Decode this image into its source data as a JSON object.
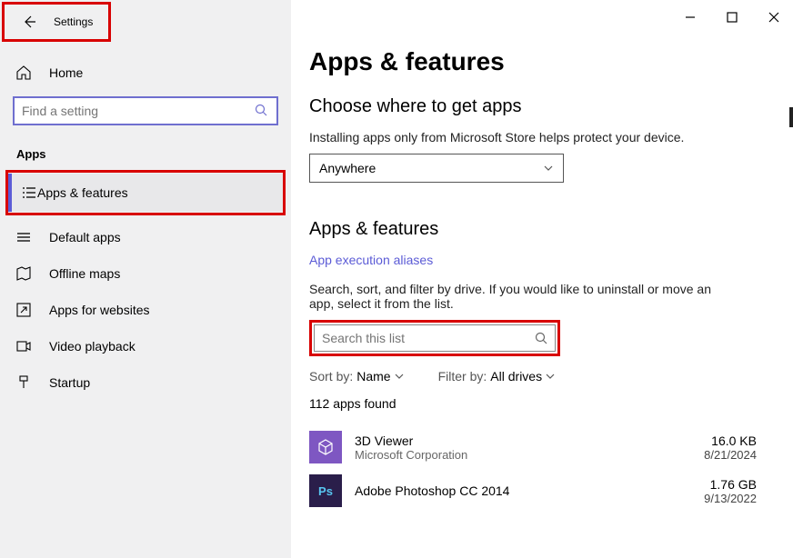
{
  "header": {
    "title": "Settings"
  },
  "sidebar": {
    "home": "Home",
    "search_placeholder": "Find a setting",
    "section": "Apps",
    "items": [
      "Apps & features",
      "Default apps",
      "Offline maps",
      "Apps for websites",
      "Video playback",
      "Startup"
    ]
  },
  "main": {
    "page_title": "Apps & features",
    "get_apps_heading": "Choose where to get apps",
    "get_apps_desc": "Installing apps only from Microsoft Store helps protect your device.",
    "get_apps_value": "Anywhere",
    "section_heading": "Apps & features",
    "aliases_link": "App execution aliases",
    "list_desc": "Search, sort, and filter by drive. If you would like to uninstall or move an app, select it from the list.",
    "search_placeholder": "Search this list",
    "sort_label": "Sort by:",
    "sort_value": "Name",
    "filter_label": "Filter by:",
    "filter_value": "All drives",
    "count": "112 apps found",
    "apps": [
      {
        "name": "3D Viewer",
        "publisher": "Microsoft Corporation",
        "size": "16.0 KB",
        "date": "8/21/2024"
      },
      {
        "name": "Adobe Photoshop CC 2014",
        "publisher": "",
        "size": "1.76 GB",
        "date": "9/13/2022"
      }
    ]
  }
}
